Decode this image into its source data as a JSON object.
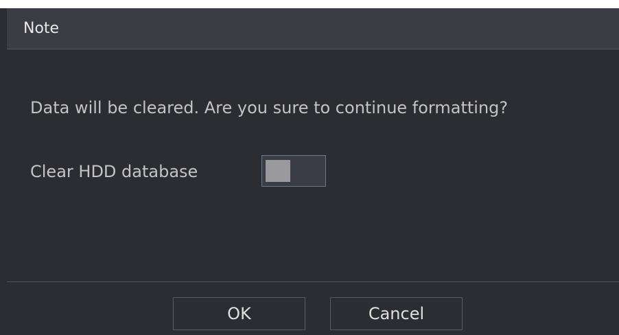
{
  "dialog": {
    "title": "Note",
    "message": "Data will be cleared. Are you sure to continue formatting?",
    "clear_hdd_option": {
      "label": "Clear HDD database",
      "enabled": false
    },
    "buttons": {
      "ok_label": "OK",
      "cancel_label": "Cancel"
    }
  },
  "colors": {
    "background": "#2c2c33",
    "title_bar": "#3c3c44",
    "text": "#c4c4c4",
    "toggle_border": "#6a7a86",
    "toggle_knob": "#9a9a9e"
  }
}
